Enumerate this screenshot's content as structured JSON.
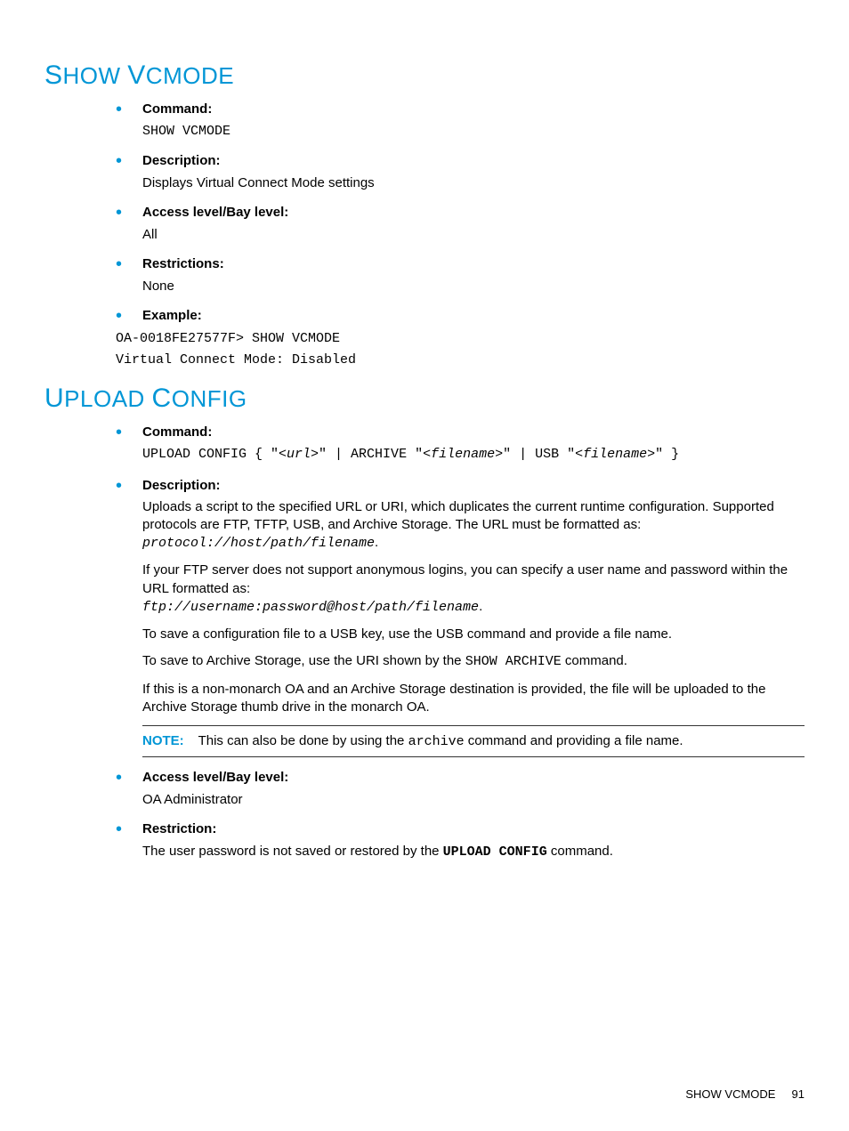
{
  "section1": {
    "title": "SHOW VCMODE",
    "items": {
      "command": {
        "label": "Command:",
        "value": "SHOW VCMODE"
      },
      "description": {
        "label": "Description:",
        "value": "Displays Virtual Connect Mode settings"
      },
      "access": {
        "label": "Access level/Bay level:",
        "value": "All"
      },
      "restrictions": {
        "label": "Restrictions:",
        "value": "None"
      },
      "example": {
        "label": "Example:",
        "line1": "OA-0018FE27577F> SHOW VCMODE",
        "line2": "Virtual Connect Mode: Disabled"
      }
    }
  },
  "section2": {
    "title": "UPLOAD CONFIG",
    "items": {
      "command": {
        "label": "Command:",
        "prefix": "UPLOAD CONFIG { \"<",
        "url": "url",
        "mid1": ">\" | ARCHIVE \"<",
        "filename1": "filename",
        "mid2": ">\" | USB \"<",
        "filename2": "filename",
        "suffix": ">\" }"
      },
      "description": {
        "label": "Description:",
        "p1": "Uploads a script to the specified URL or URI, which duplicates the current runtime configuration. Supported protocols are FTP, TFTP, USB, and Archive Storage. The URL must be formatted as:",
        "p1_code": "protocol://host/path/filename",
        "p1_end": ".",
        "p2": "If your FTP server does not support anonymous logins, you can specify a user name and password within the URL formatted as:",
        "p2_code": "ftp://username:password@host/path/filename",
        "p2_end": ".",
        "p3": "To save a configuration file to a USB key, use the USB command and provide a file name.",
        "p4a": "To save to Archive Storage, use the URI shown by the ",
        "p4_code": "SHOW ARCHIVE",
        "p4b": " command.",
        "p5": "If this is a non-monarch OA and an Archive Storage destination is provided, the file will be uploaded to the Archive Storage thumb drive in the monarch OA.",
        "note_label": "NOTE:",
        "note_a": "This can also be done by using the ",
        "note_code": "archive",
        "note_b": " command and providing a file name."
      },
      "access": {
        "label": "Access level/Bay level:",
        "value": "OA Administrator"
      },
      "restriction": {
        "label": "Restriction:",
        "text_a": "The user password is not saved or restored by the ",
        "text_code": "UPLOAD CONFIG",
        "text_b": " command."
      }
    }
  },
  "footer": {
    "title": "SHOW VCMODE",
    "page": "91"
  }
}
